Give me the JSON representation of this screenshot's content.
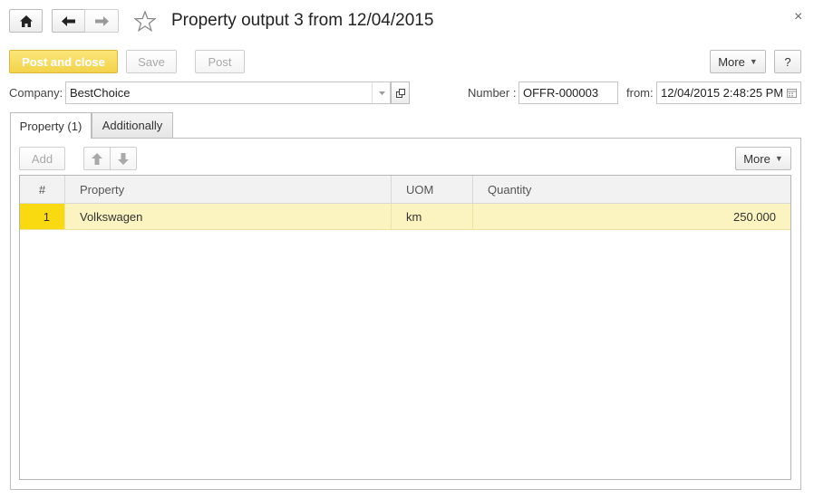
{
  "window": {
    "title": "Property output 3 from 12/04/2015",
    "close_glyph": "×"
  },
  "nav": {
    "home_icon": "home-icon",
    "back_icon": "arrow-left-icon",
    "forward_icon": "arrow-right-icon",
    "favorite_icon": "star-icon"
  },
  "toolbar": {
    "post_and_close": "Post and close",
    "save": "Save",
    "post": "Post",
    "more": "More",
    "help": "?"
  },
  "header": {
    "company_label": "Company:",
    "company_value": "BestChoice",
    "number_label": "Number :",
    "number_value": "OFFR-000003",
    "from_label": "from:",
    "from_value": "12/04/2015  2:48:25 PM"
  },
  "tabs": [
    {
      "label": "Property (1)",
      "active": true
    },
    {
      "label": "Additionally",
      "active": false
    }
  ],
  "table_toolbar": {
    "add": "Add",
    "move_up_icon": "arrow-up-icon",
    "move_down_icon": "arrow-down-icon",
    "more": "More"
  },
  "table": {
    "columns": [
      "#",
      "Property",
      "UOM",
      "Quantity"
    ],
    "rows": [
      {
        "num": "1",
        "property": "Volkswagen",
        "uom": "km",
        "quantity": "250.000"
      }
    ]
  },
  "colors": {
    "accent_yellow": "#f3d34a",
    "selected_row": "#fbf3c0",
    "row_number_highlight": "#f9d90f"
  }
}
